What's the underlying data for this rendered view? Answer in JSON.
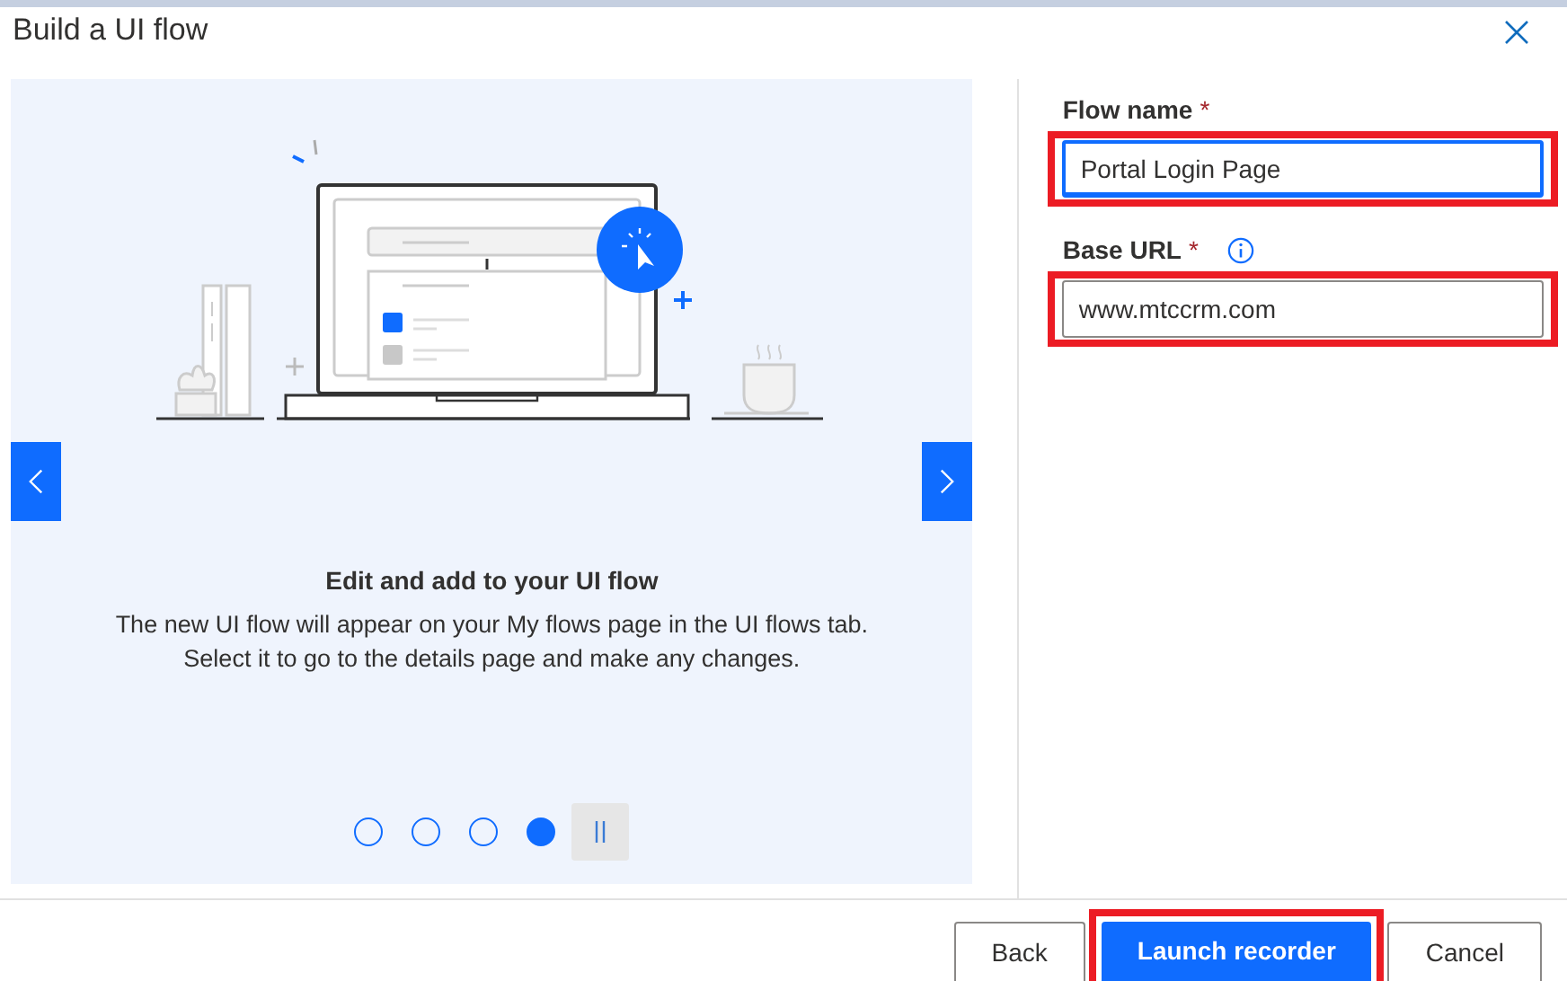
{
  "dialog": {
    "title": "Build a UI flow"
  },
  "carousel": {
    "heading": "Edit and add to your UI flow",
    "description": "The new UI flow will appear on your My flows page in the UI flows tab. Select it to go to the details page and make any changes.",
    "dots": [
      {
        "selected": false
      },
      {
        "selected": false
      },
      {
        "selected": false
      },
      {
        "selected": true
      }
    ]
  },
  "form": {
    "fields": [
      {
        "label": "Flow name",
        "required_mark": "*",
        "value": "Portal Login Page",
        "focused": true,
        "highlighted": true,
        "info": false
      },
      {
        "label": "Base URL",
        "required_mark": "*",
        "value": "www.mtccrm.com",
        "focused": false,
        "highlighted": true,
        "info": true
      }
    ]
  },
  "buttons": [
    {
      "label": "Back",
      "primary": false,
      "highlighted": false
    },
    {
      "label": "Launch recorder",
      "primary": true,
      "highlighted": true
    },
    {
      "label": "Cancel",
      "primary": false,
      "highlighted": false
    }
  ]
}
